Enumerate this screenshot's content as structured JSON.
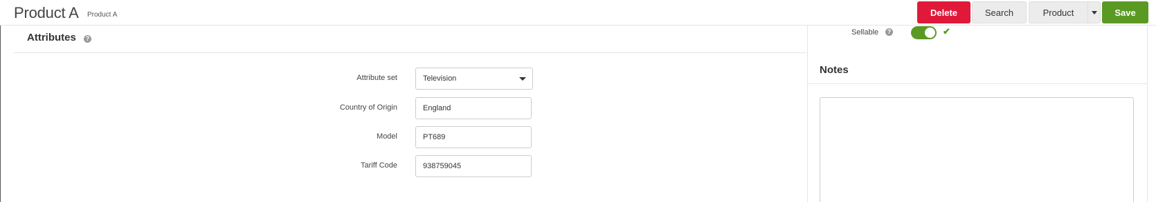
{
  "header": {
    "title": "Product A",
    "subtitle": "Product A",
    "buttons": {
      "delete": "Delete",
      "search": "Search",
      "product": "Product",
      "save": "Save"
    }
  },
  "attributes": {
    "section_title": "Attributes",
    "fields": [
      {
        "label": "Attribute set",
        "value": "Television",
        "type": "select"
      },
      {
        "label": "Country of Origin",
        "value": "England",
        "type": "text"
      },
      {
        "label": "Model",
        "value": "PT689",
        "type": "text"
      },
      {
        "label": "Tariff Code",
        "value": "938759045",
        "type": "text"
      }
    ]
  },
  "sidebar": {
    "sellable_label": "Sellable",
    "sellable_on": true,
    "notes_title": "Notes",
    "notes_value": ""
  },
  "colors": {
    "delete": "#e0193a",
    "save": "#5a9a22",
    "toggle_on": "#5a9a22"
  },
  "icons": {
    "help": "question-circle-icon",
    "check": "check-icon",
    "caret": "caret-down-icon"
  }
}
